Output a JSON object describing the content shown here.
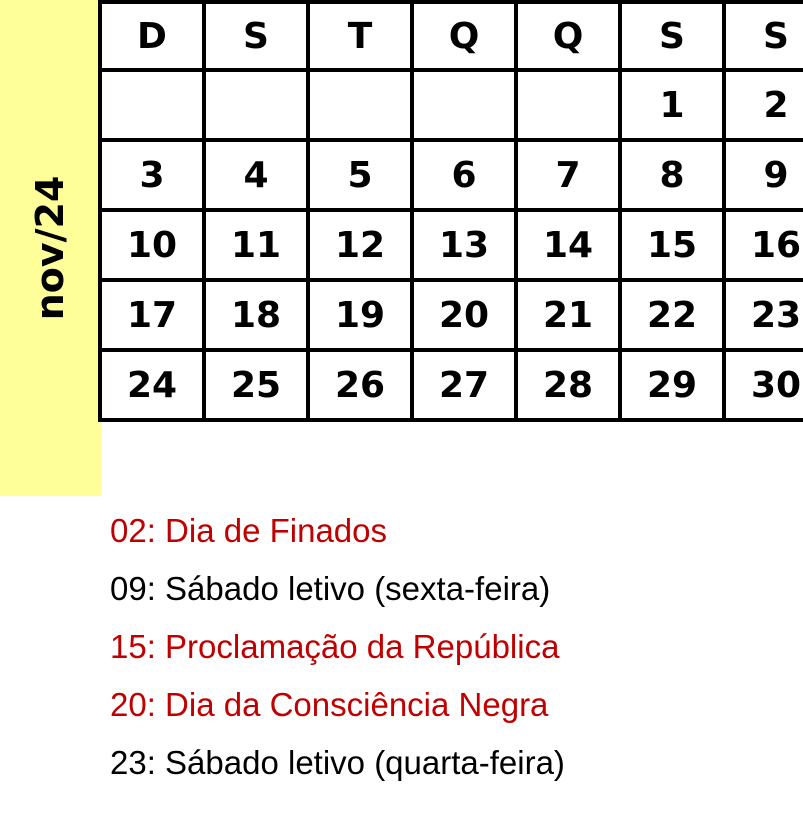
{
  "month_label": "nov/24",
  "colors": {
    "school_day": "#ffc000",
    "holiday": "#ff0066",
    "month_band": "#ffff99",
    "legend_holiday_text": "#c00000"
  },
  "weekdays": [
    "D",
    "S",
    "T",
    "Q",
    "Q",
    "S",
    "S"
  ],
  "weeks": [
    [
      {
        "day": "",
        "type": "empty"
      },
      {
        "day": "",
        "type": "empty"
      },
      {
        "day": "",
        "type": "empty"
      },
      {
        "day": "",
        "type": "empty"
      },
      {
        "day": "",
        "type": "empty"
      },
      {
        "day": "1",
        "type": "school"
      },
      {
        "day": "2",
        "type": "holiday"
      }
    ],
    [
      {
        "day": "3",
        "type": "weekend"
      },
      {
        "day": "4",
        "type": "school"
      },
      {
        "day": "5",
        "type": "school"
      },
      {
        "day": "6",
        "type": "school"
      },
      {
        "day": "7",
        "type": "school"
      },
      {
        "day": "8",
        "type": "school"
      },
      {
        "day": "9",
        "type": "school"
      }
    ],
    [
      {
        "day": "10",
        "type": "weekend"
      },
      {
        "day": "11",
        "type": "school"
      },
      {
        "day": "12",
        "type": "school"
      },
      {
        "day": "13",
        "type": "school"
      },
      {
        "day": "14",
        "type": "school"
      },
      {
        "day": "15",
        "type": "holiday"
      },
      {
        "day": "16",
        "type": "weekend"
      }
    ],
    [
      {
        "day": "17",
        "type": "weekend"
      },
      {
        "day": "18",
        "type": "school"
      },
      {
        "day": "19",
        "type": "school"
      },
      {
        "day": "20",
        "type": "holiday"
      },
      {
        "day": "21",
        "type": "school"
      },
      {
        "day": "22",
        "type": "school"
      },
      {
        "day": "23",
        "type": "school"
      }
    ],
    [
      {
        "day": "24",
        "type": "weekend"
      },
      {
        "day": "25",
        "type": "school"
      },
      {
        "day": "26",
        "type": "school"
      },
      {
        "day": "27",
        "type": "school"
      },
      {
        "day": "28",
        "type": "school"
      },
      {
        "day": "29",
        "type": "school"
      },
      {
        "day": "30",
        "type": "weekend"
      }
    ]
  ],
  "legend": [
    {
      "text": "02: Dia de Finados",
      "kind": "red"
    },
    {
      "text": "09: Sábado letivo (sexta-feira)",
      "kind": "black"
    },
    {
      "text": "15: Proclamação da República",
      "kind": "red"
    },
    {
      "text": "20: Dia da Consciência Negra",
      "kind": "red"
    },
    {
      "text": "23: Sábado letivo (quarta-feira)",
      "kind": "black"
    }
  ]
}
